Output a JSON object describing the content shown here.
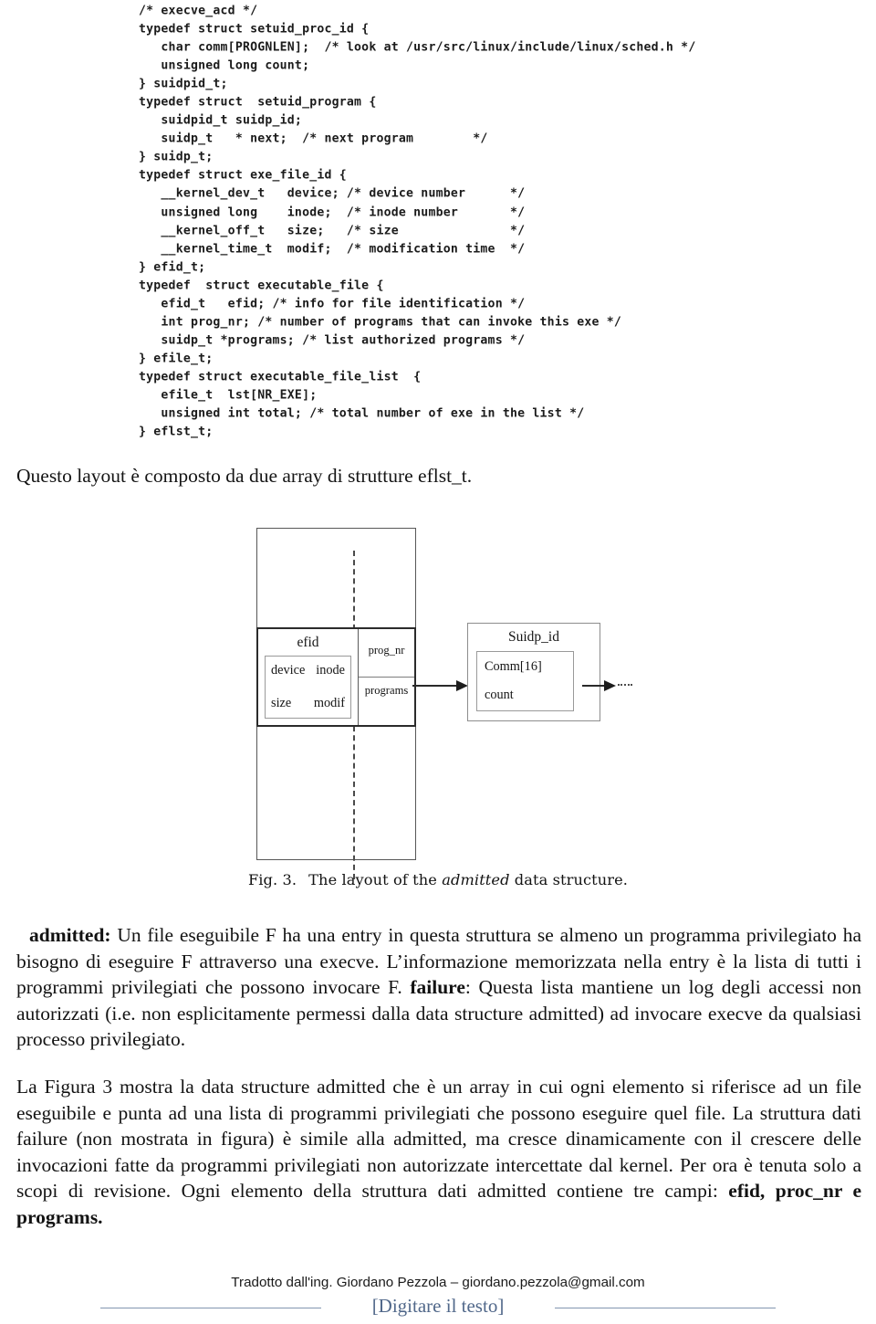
{
  "code_listing": {
    "name": "execve_acd-structures",
    "lines": [
      "/* execve_acd */",
      "typedef struct setuid_proc_id {",
      "   char comm[PROGNLEN];  /* look at /usr/src/linux/include/linux/sched.h */",
      "   unsigned long count;",
      "} suidpid_t;",
      "typedef struct  setuid_program {",
      "   suidpid_t suidp_id;",
      "   suidp_t   * next;  /* next program        */",
      "} suidp_t;",
      "typedef struct exe_file_id {",
      "   __kernel_dev_t   device; /* device number      */",
      "   unsigned long    inode;  /* inode number       */",
      "   __kernel_off_t   size;   /* size               */",
      "   __kernel_time_t  modif;  /* modification time  */",
      "} efid_t;",
      "typedef  struct executable_file {",
      "   efid_t   efid; /* info for file identification */",
      "   int prog_nr; /* number of programs that can invoke this exe */",
      "   suidp_t *programs; /* list authorized programs */",
      "} efile_t;",
      "typedef struct executable_file_list  {",
      "   efile_t  lst[NR_EXE];",
      "   unsigned int total; /* total number of exe in the list */",
      "} eflst_t;"
    ]
  },
  "lead_line": "Questo layout è composto da due array di strutture eflst_t.",
  "figure": {
    "element": {
      "efid_label": "efid",
      "efid_fields": {
        "device": "device",
        "inode": "inode",
        "size": "size",
        "modif": "modif"
      },
      "prog_nr_label": "prog_nr",
      "programs_label": "programs"
    },
    "suidp_node": {
      "title": "Suidp_id",
      "comm": "Comm[16]",
      "count": "count"
    },
    "caption": {
      "number": "Fig. 3.",
      "text_before": "The layout of the ",
      "emphasis": "admitted",
      "text_after": " data structure."
    }
  },
  "paragraphs": {
    "definitions": {
      "admitted_term": "admitted:",
      "admitted_text": " Un file eseguibile F ha una entry in questa struttura se almeno un programma privilegiato ha bisogno di eseguire F attraverso una execve. L’informazione memorizzata nella entry è la lista di tutti i programmi privilegiati che possono invocare F.",
      "failure_term": "failure",
      "failure_text": ": Questa lista mantiene un log degli accessi non autorizzati (i.e. non esplicitamente permessi dalla data structure admitted) ad invocare execve da qualsiasi processo privilegiato."
    },
    "final": {
      "text_main": "La Figura 3 mostra la data structure admitted che è un array in cui ogni elemento si riferisce ad un file eseguibile e punta ad una lista di programmi privilegiati che possono eseguire quel file.  La struttura dati failure (non mostrata in figura) è simile alla admitted, ma cresce dinamicamente con il crescere delle invocazioni fatte da programmi privilegiati non autorizzate intercettate dal kernel.  Per ora è tenuta solo a scopi di revisione. Ogni elemento della struttura dati admitted contiene tre campi: ",
      "fields_bold": "efid, proc_nr e programs."
    }
  },
  "footer": {
    "credit": "Tradotto dall'ing. Giordano Pezzola – giordano.pezzola@gmail.com",
    "placeholder": "[Digitare il testo]",
    "rule_color": "#8296b0",
    "placeholder_color": "#51688a"
  }
}
